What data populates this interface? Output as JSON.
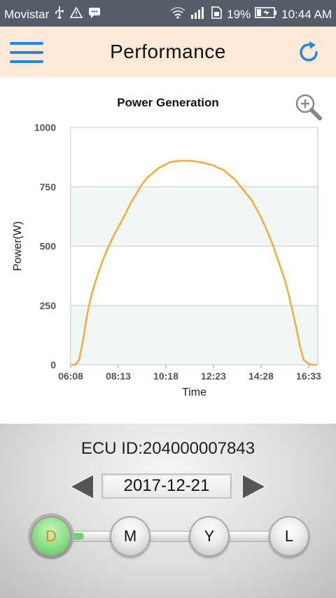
{
  "status_bar": {
    "carrier": "Movistar",
    "battery_percent": "19%",
    "time": "10:44 AM",
    "icons": [
      "usb-icon",
      "warning-icon",
      "message-icon",
      "wifi-icon",
      "signal-icon",
      "sim-icon",
      "battery-icon"
    ]
  },
  "app_bar": {
    "title": "Performance",
    "accent_color": "#1e88e5",
    "background": "#fde9d6"
  },
  "chart_data": {
    "type": "area",
    "title": "Power Generation",
    "xlabel": "Time",
    "ylabel": "Power(W)",
    "ylim": [
      0,
      1000
    ],
    "yticks": [
      "0",
      "250",
      "500",
      "750",
      "1000"
    ],
    "xticks": [
      "06:08",
      "08:13",
      "10:18",
      "12:23",
      "14:28",
      "16:33"
    ],
    "series_color": "#f5a93a",
    "grid": true,
    "x": [
      "06:08",
      "06:20",
      "06:30",
      "06:40",
      "06:50",
      "07:00",
      "07:15",
      "07:30",
      "07:45",
      "08:00",
      "08:13",
      "08:30",
      "08:45",
      "09:00",
      "09:15",
      "09:30",
      "09:45",
      "10:00",
      "10:18",
      "10:30",
      "10:45",
      "11:00",
      "11:15",
      "11:30",
      "11:45",
      "12:00",
      "12:10",
      "12:23",
      "12:35",
      "12:50",
      "13:05",
      "13:20",
      "13:35",
      "13:50",
      "14:05",
      "14:15",
      "14:28",
      "14:45",
      "15:00",
      "15:15",
      "15:30",
      "15:40",
      "15:50",
      "16:00",
      "16:10",
      "16:20",
      "16:33",
      "16:40",
      "16:50",
      "16:55"
    ],
    "values": [
      0,
      0,
      20,
      100,
      200,
      280,
      360,
      430,
      490,
      540,
      580,
      630,
      680,
      720,
      760,
      790,
      810,
      830,
      845,
      855,
      858,
      860,
      860,
      858,
      855,
      850,
      845,
      840,
      830,
      820,
      800,
      780,
      750,
      720,
      690,
      660,
      620,
      560,
      500,
      430,
      360,
      300,
      230,
      160,
      80,
      20,
      5,
      0,
      0,
      0
    ]
  },
  "bottom": {
    "ecu_label": "ECU ID:",
    "ecu_id": "204000007843",
    "date": "2017-12-21",
    "periods": [
      "D",
      "M",
      "Y",
      "L"
    ],
    "active_period": "D"
  }
}
